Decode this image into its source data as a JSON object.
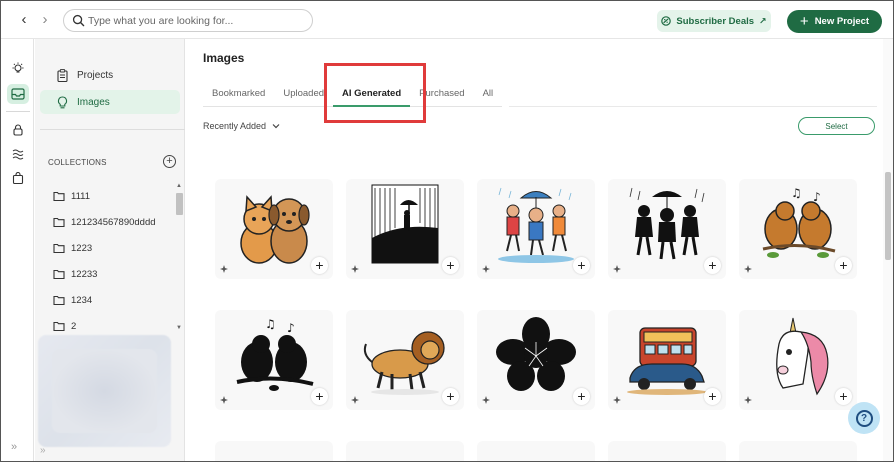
{
  "topbar": {
    "search_placeholder": "Type what you are looking for...",
    "deals_label": "Subscriber Deals",
    "new_project_label": "New Project",
    "accent": "#1f6b43"
  },
  "sidebar": {
    "items": [
      {
        "label": "Projects",
        "icon": "clipboard-icon",
        "active": false
      },
      {
        "label": "Images",
        "icon": "lightbulb-icon",
        "active": true
      }
    ],
    "collections_label": "COLLECTIONS",
    "collections": [
      "1111",
      "121234567890dddd",
      "1223",
      "12233",
      "1234",
      "2"
    ]
  },
  "main": {
    "title": "Images",
    "tabs": [
      {
        "label": "Bookmarked",
        "active": false
      },
      {
        "label": "Uploaded",
        "active": false
      },
      {
        "label": "AI Generated",
        "active": true
      },
      {
        "label": "Purchased",
        "active": false
      },
      {
        "label": "All",
        "active": false
      }
    ],
    "sort_label": "Recently Added",
    "select_label": "Select",
    "images": [
      {
        "name": "cat-and-dog"
      },
      {
        "name": "silhouette-umbrella-rain"
      },
      {
        "name": "children-dancing-rain"
      },
      {
        "name": "children-silhouette-rain"
      },
      {
        "name": "birds-singing-branch"
      },
      {
        "name": "birds-silhouette-singing"
      },
      {
        "name": "lion-walking"
      },
      {
        "name": "flower-silhouette"
      },
      {
        "name": "retro-bus-car"
      },
      {
        "name": "unicorn-head"
      }
    ]
  },
  "colors": {
    "accent_green": "#1f6b43",
    "tab_underline": "#3a9b6b",
    "highlight_red": "#e03b3b",
    "help_bg": "#bfe3f5"
  }
}
